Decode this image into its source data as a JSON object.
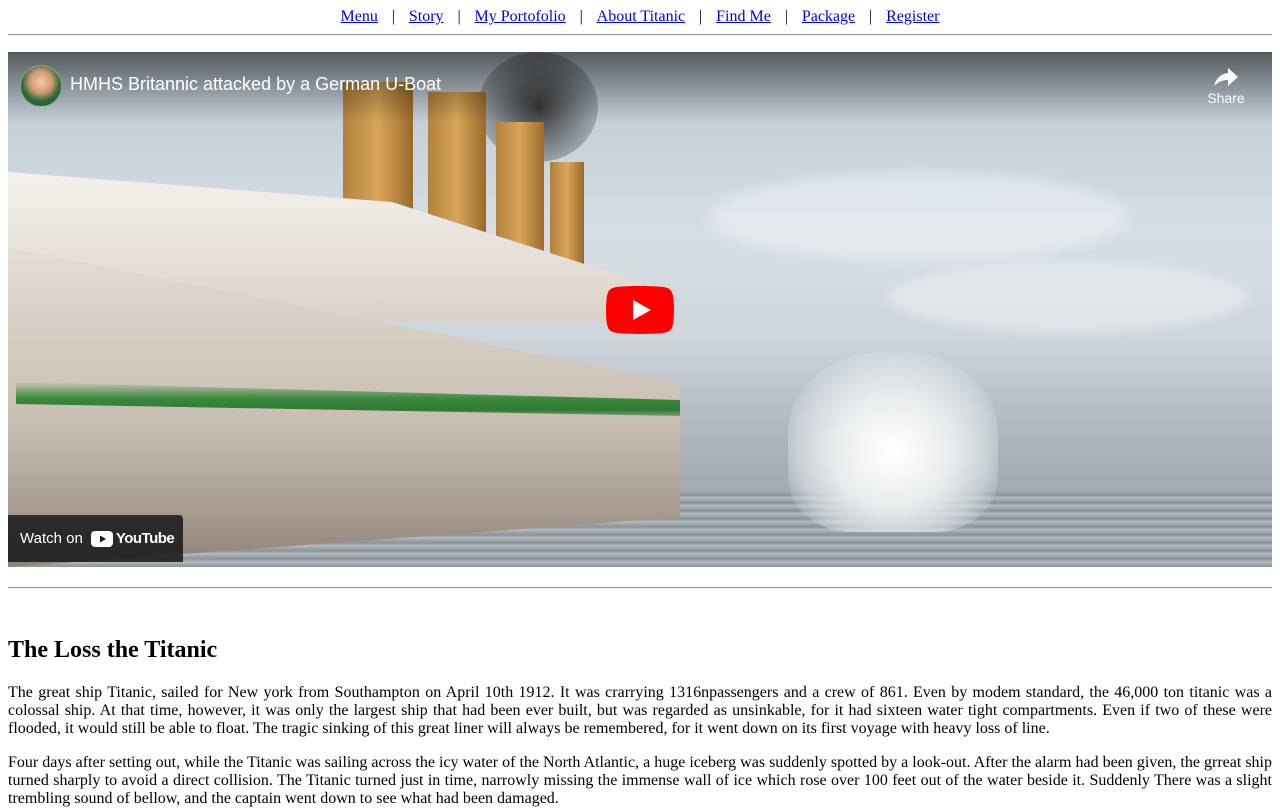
{
  "nav": {
    "items": [
      {
        "label": "Menu"
      },
      {
        "label": "Story"
      },
      {
        "label": "My Portofolio"
      },
      {
        "label": "About Titanic"
      },
      {
        "label": "Find Me"
      },
      {
        "label": "Package"
      },
      {
        "label": "Register"
      }
    ],
    "separator": "|"
  },
  "video": {
    "title": "HMHS Britannic attacked by a German U-Boat",
    "share_label": "Share",
    "watch_on_label": "Watch on",
    "youtube_wordmark": "YouTube",
    "icons": {
      "avatar": "channel-avatar",
      "share": "share-icon",
      "play": "play-icon",
      "youtube": "youtube-logo-icon"
    },
    "colors": {
      "play_red": "#ff0000"
    }
  },
  "article": {
    "heading": "The Loss the Titanic",
    "paragraphs": [
      "The great ship Titanic, sailed for New york from Southampton on April 10th 1912. It was crarrying 1316npassengers and a crew of 861. Even by modem standard, the 46,000 ton titanic was a colossal ship. At that time, however, it was only the largest ship that had been ever built, but was regarded as unsinkable, for it had sixteen water tight compartments. Even if two of these were flooded, it would still be able to float. The tragic sinking of this great liner will always be remembered, for it went down on its first voyage with heavy loss of line.",
      "Four days after setting out, while the Titanic was sailing across the icy water of the North Atlantic, a huge iceberg was suddenly spotted by a look-out. After the alarm had been given, the grreat ship turned sharply to avoid a direct collision. The Titanic turned just in time, narrowly missing the immense wall of ice which rose over 100 feet out of the water beside it. Suddenly There was a slight trembling sound of bellow, and the captain went down to see what had been damaged."
    ]
  }
}
